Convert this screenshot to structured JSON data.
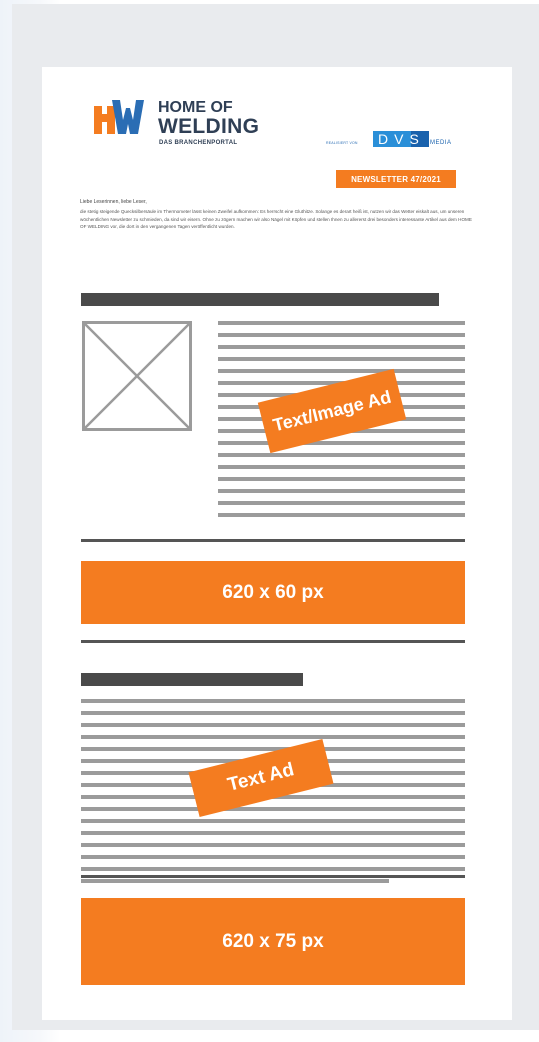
{
  "header": {
    "logo_line1": "HOME OF",
    "logo_line2": "WELDING",
    "logo_tagline": "DAS BRANCHENPORTAL",
    "realisiert_label": "REALISIERT VON",
    "partner_logo": "DVS",
    "partner_suffix": "MEDIA",
    "newsletter_badge": "NEWSLETTER 47/2021"
  },
  "intro": {
    "greeting": "Liebe Leserinnen, liebe Leser,",
    "body": "die stetig steigende Quecksilbersäule im Thermometer lässt keinen Zweifel aufkommen: Es herrscht eine Gluthitze. Solange es derart heiß ist, nutzen wir das Wetter eiskalt aus, um unseren wöchentlichen Newsletter zu schmieden, da sind wir eisern. Ohne zu zögern machen wir also Nägel mit Köpfen und stellen Ihnen zu allererst drei besonders interessante Artikel aus dem HOME OF WELDING vor, die dort in den vergangenen Tagen veröffentlicht wurden."
  },
  "ads": {
    "text_image_ad": "Text/Image Ad",
    "banner_1": "620 x 60 px",
    "text_ad": "Text Ad",
    "banner_2": "620 x 75 px"
  },
  "colors": {
    "accent_orange": "#f47c20",
    "logo_blue": "#2a6db4",
    "dark_text": "#2f3f55",
    "placeholder_grey": "#9b9b9b",
    "bar_dark": "#4a4a4a"
  },
  "icons": {
    "logo": "hw-logo",
    "partner": "dvs-logo",
    "image_placeholder": "image-placeholder-icon"
  }
}
